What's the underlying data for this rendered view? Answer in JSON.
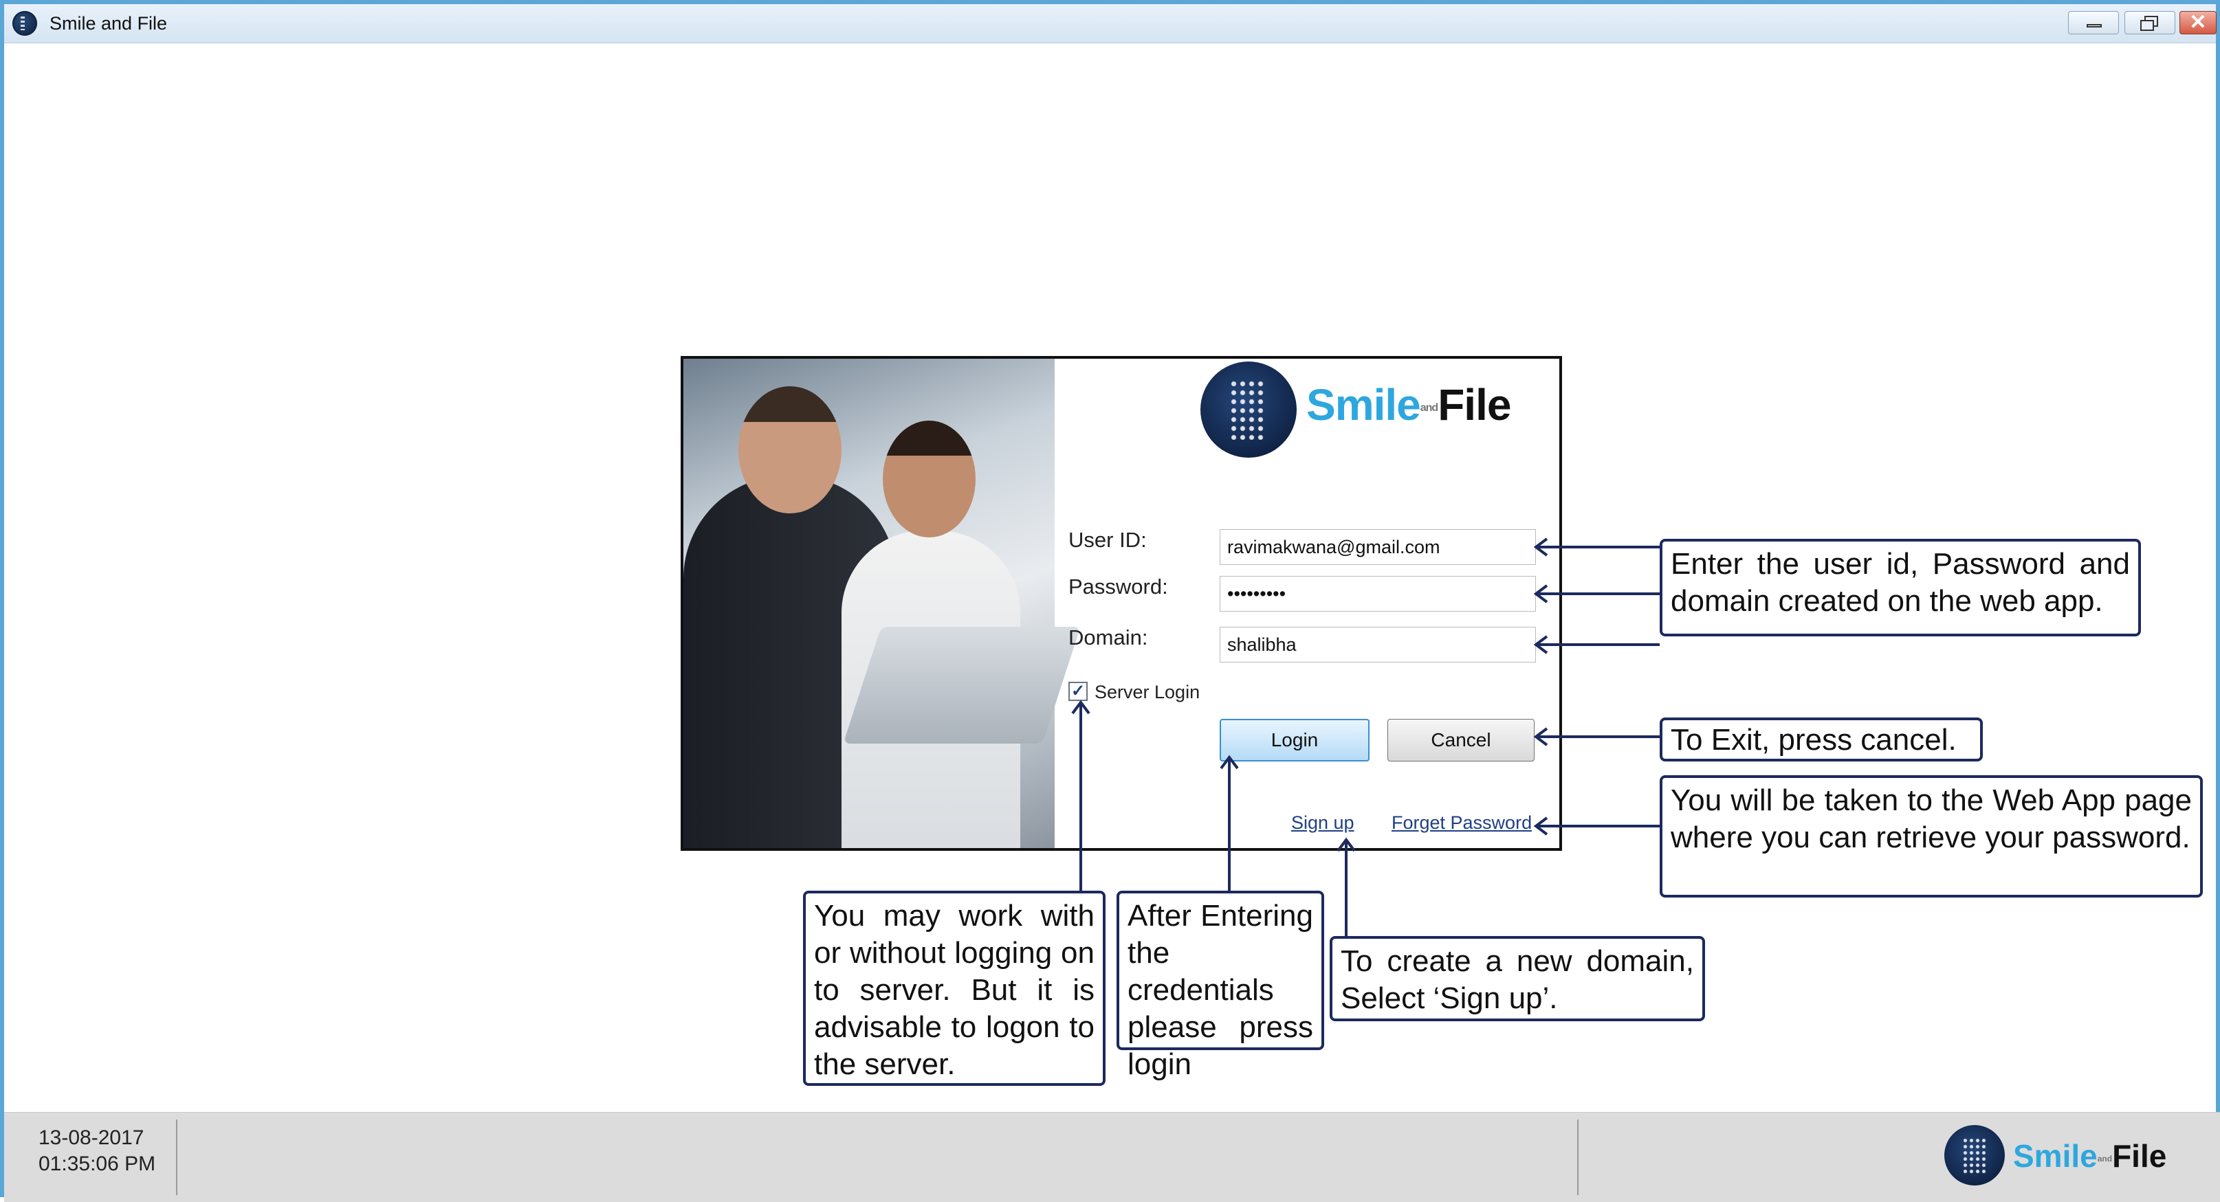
{
  "window": {
    "title": "Smile and File",
    "close_glyph": "✕"
  },
  "logo": {
    "smile": "Smile",
    "and": "and",
    "file": "File"
  },
  "login": {
    "userid_label": "User ID:",
    "userid_value": "ravimakwana@gmail.com",
    "password_label": "Password:",
    "password_value": "passwords",
    "domain_label": "Domain:",
    "domain_value": "shalibha",
    "server_login_label": "Server Login",
    "server_login_checked": "✓",
    "login_button": "Login",
    "cancel_button": "Cancel",
    "signup_link": "Sign up",
    "forget_password_link": "Forget Password"
  },
  "callouts": {
    "credentials": "Enter the user id, Password and domain created on the web app.",
    "exit": "To Exit, press cancel.",
    "forget_password": "You will be taken to the Web App page where you can retrieve your password.",
    "server_login": "You may work with or without logging on to server. But it is advisable to logon to the server.",
    "login": "After Entering the credentials please press login",
    "signup": "To create a new domain, Select ‘Sign up’."
  },
  "statusbar": {
    "date": "13-08-2017",
    "time": "01:35:06 PM"
  },
  "colors": {
    "window_border": "#5aa6d6",
    "accent_blue": "#2ea7df",
    "callout_border": "#1c2a5e"
  }
}
